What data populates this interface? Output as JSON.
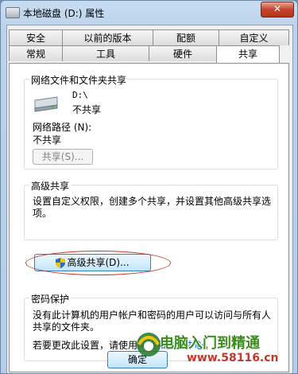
{
  "window": {
    "title": "本地磁盘 (D:) 属性",
    "close_glyph": "✕"
  },
  "tabs_row1": [
    "安全",
    "以前的版本",
    "配额",
    "自定义"
  ],
  "tabs_row2": [
    "常规",
    "工具",
    "硬件",
    "共享"
  ],
  "network_sharing": {
    "group_label": "网络文件和文件夹共享",
    "drive_name": "D:\\",
    "status": "不共享",
    "path_label": "网络路径 (N):",
    "path_value": "不共享",
    "share_button": "共享(S)..."
  },
  "advanced_sharing": {
    "group_label": "高级共享",
    "description_line1": "设置自定义权限，创建多个共享，并设置其他高级共享选",
    "description_line2": "项。",
    "button": "高级共享(D)..."
  },
  "password_protection": {
    "group_label": "密码保护",
    "line1": "没有此计算机的用户帐户和密码的用户可以访问与所有人",
    "line2": "共享的文件夹。",
    "line3_prefix": "若要更改此设置，请使用",
    "link": "网络和共享中心",
    "line3_suffix": "。"
  },
  "footer": {
    "ok_button": "确定"
  },
  "watermark": {
    "line1": "电脑入门到精通",
    "line2": "www.58116.cn"
  }
}
